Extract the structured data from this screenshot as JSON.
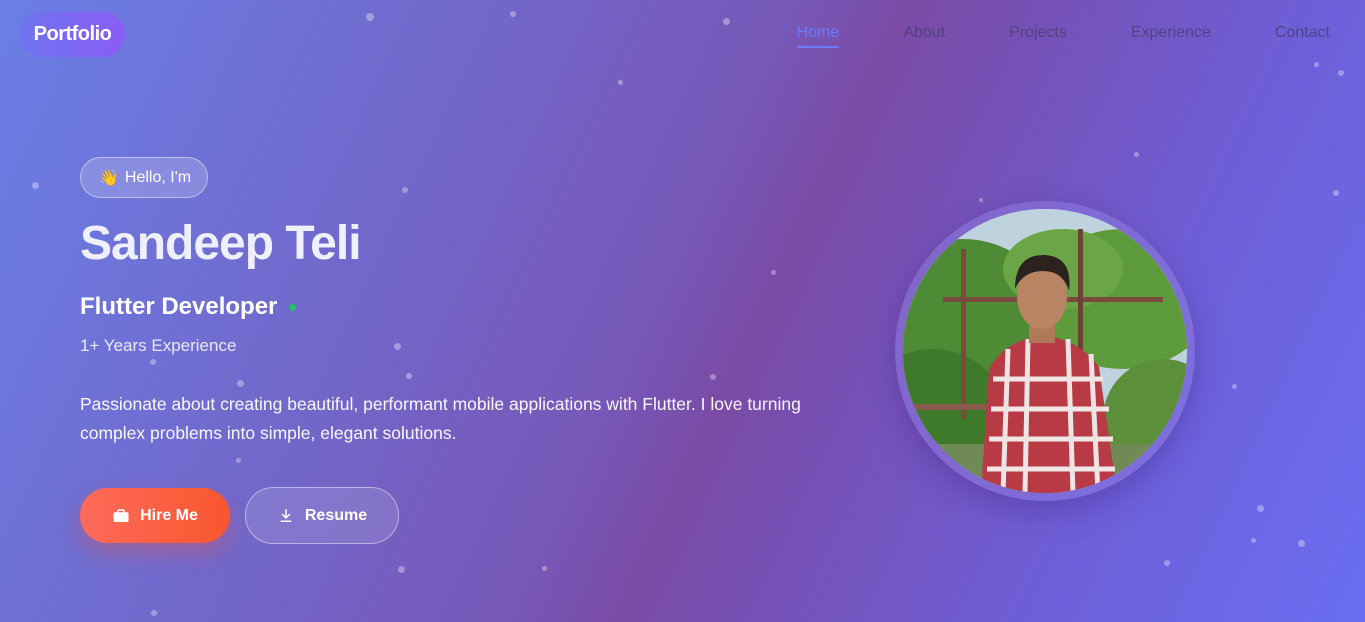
{
  "nav": {
    "logo": "Portfolio",
    "items": [
      {
        "label": "Home",
        "active": true
      },
      {
        "label": "About",
        "active": false
      },
      {
        "label": "Projects",
        "active": false
      },
      {
        "label": "Experience",
        "active": false
      },
      {
        "label": "Contact",
        "active": false
      }
    ]
  },
  "hero": {
    "greeting": "Hello, I'm",
    "greeting_icon": "waving-hand-icon",
    "name": "Sandeep Teli",
    "role": "Flutter Developer",
    "experience": "1+ Years Experience",
    "description": "Passionate about creating beautiful, performant mobile applications with Flutter. I love turning complex problems into simple, elegant solutions.",
    "hire_button": "Hire Me",
    "hire_icon": "briefcase-icon",
    "resume_button": "Resume",
    "resume_icon": "download-icon"
  },
  "colors": {
    "accent": "#6a7cf8",
    "hire_gradient_start": "#ff6a5b",
    "hire_gradient_end": "#f9562e",
    "status_dot": "#22c55e"
  }
}
